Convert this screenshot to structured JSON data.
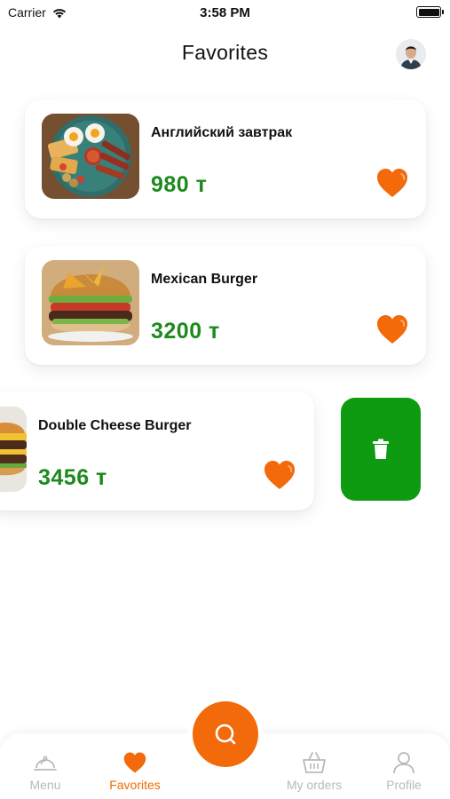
{
  "status_bar": {
    "carrier": "Carrier",
    "time": "3:58 PM"
  },
  "header": {
    "title": "Favorites"
  },
  "favorites": [
    {
      "title": "Английский завтрак",
      "price": "980 т"
    },
    {
      "title": "Mexican Burger",
      "price": "3200 т"
    },
    {
      "title": "Double Cheese Burger",
      "price": "3456 т"
    }
  ],
  "tabs": [
    {
      "label": "Menu",
      "active": false
    },
    {
      "label": "Favorites",
      "active": true
    },
    {
      "label": "My orders",
      "active": false
    },
    {
      "label": "Profile",
      "active": false
    }
  ],
  "colors": {
    "accent": "#f26a0a",
    "price": "#1e8a1e",
    "delete": "#0e9b12",
    "inactive_tab": "#b9b9b9"
  },
  "icons": [
    "wifi-icon",
    "battery-icon",
    "heart-icon",
    "trash-icon",
    "search-icon",
    "menu-cloche-icon",
    "basket-icon",
    "person-icon"
  ]
}
